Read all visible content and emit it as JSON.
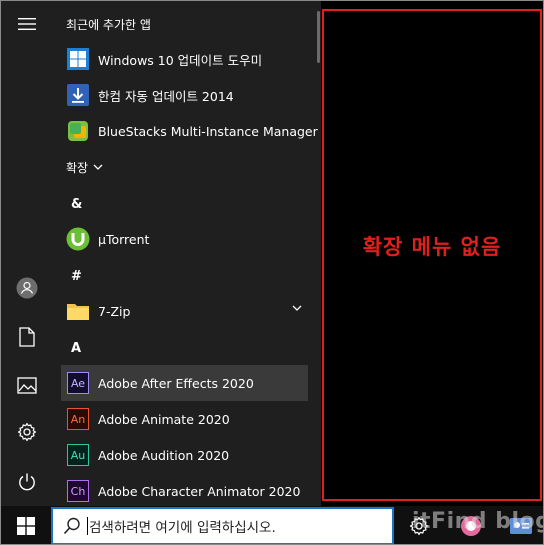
{
  "start_menu": {
    "recent_header": "최근에 추가한 앱",
    "recent_apps": [
      {
        "label": "Windows 10 업데이트 도우미",
        "icon": "windows-logo-icon"
      },
      {
        "label": "한컴 자동 업데이트 2014",
        "icon": "update-download-icon"
      },
      {
        "label": "BlueStacks Multi-Instance Manager",
        "icon": "bluestacks-icon"
      }
    ],
    "expand_label": "확장",
    "groups": {
      "amp": "&",
      "hash": "#",
      "a": "A"
    },
    "apps": {
      "utorrent": "µTorrent",
      "sevenzip": "7-Zip",
      "after_effects": "Adobe After Effects 2020",
      "animate": "Adobe Animate 2020",
      "audition": "Adobe Audition 2020",
      "character_animator": "Adobe Character Animator 2020"
    },
    "adobe_badges": {
      "after_effects": "Ae",
      "animate": "An",
      "audition": "Au",
      "character_animator": "Ch"
    },
    "tiles_message": "확장 메뉴 없음"
  },
  "taskbar": {
    "search_placeholder": "검색하려면 여기에 입력하십시오.",
    "watermark": "itFind blog"
  },
  "colors": {
    "annotation_red": "#e0201b",
    "search_border": "#1c74c8",
    "panel_bg": "#1f1f1f",
    "selected_bg": "#3a3a3a"
  }
}
